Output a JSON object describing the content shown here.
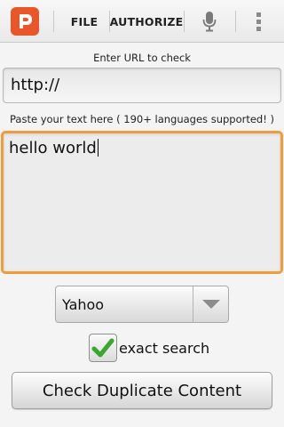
{
  "action_bar": {
    "logo_icon": "app-logo-icon",
    "file_label": "FILE",
    "authorize_label": "AUTHORIZE",
    "mic_icon": "microphone-icon",
    "overflow_icon": "overflow-menu-icon"
  },
  "url_section": {
    "label": "Enter URL to check",
    "value": "http://"
  },
  "text_section": {
    "label": "Paste your text here ( 190+ languages supported! )",
    "value": "hello world"
  },
  "search_engine": {
    "selected": "Yahoo",
    "arrow_icon": "dropdown-triangle-icon"
  },
  "exact_search": {
    "label": "exact search",
    "checked": true
  },
  "submit": {
    "label": "Check Duplicate Content"
  },
  "colors": {
    "accent": "#e8562a",
    "focus_border": "#f29b3c",
    "checkmark": "#3aa82c"
  }
}
